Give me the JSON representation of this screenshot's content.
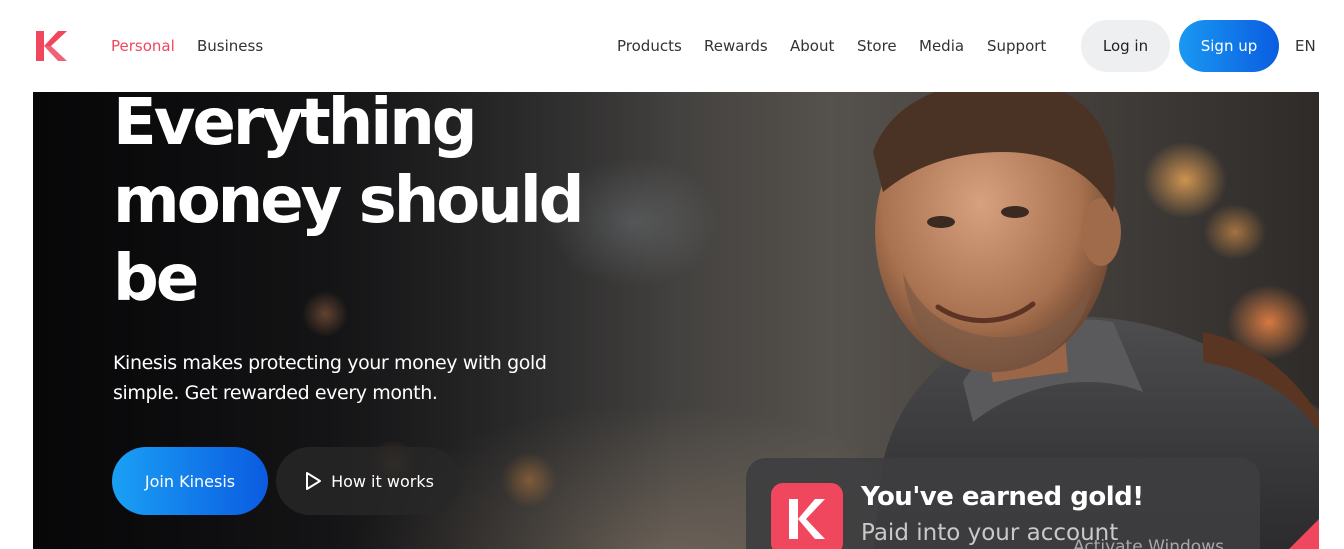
{
  "brand": {
    "accent": "#f0475e",
    "primary_blue": "#0b5be0"
  },
  "header": {
    "segments": [
      "Personal",
      "Business"
    ],
    "nav": [
      "Products",
      "Rewards",
      "About",
      "Store",
      "Media",
      "Support"
    ],
    "login_label": "Log in",
    "signup_label": "Sign up",
    "language": "EN"
  },
  "hero": {
    "title_lines": [
      "Everything",
      "money should",
      "be"
    ],
    "subtitle_lines": [
      "Kinesis makes protecting your money with gold",
      "simple. Get rewarded every month."
    ],
    "cta_primary": "Join Kinesis",
    "cta_secondary": "How it works",
    "cta_secondary_icon": "play-icon"
  },
  "notification": {
    "icon": "kinesis-logo-icon",
    "title": "You've earned gold!",
    "subtitle": "Paid into your account"
  },
  "system": {
    "watermark": "Activate Windows"
  }
}
